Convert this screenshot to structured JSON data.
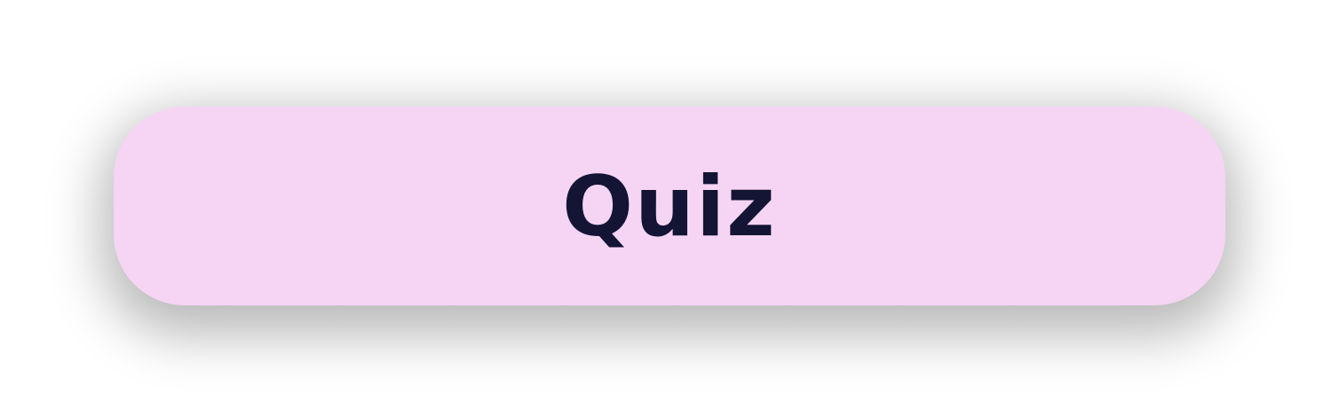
{
  "quiz_button": {
    "label": "Quiz",
    "background_color": "#f6d5f4",
    "text_color": "#141435"
  }
}
